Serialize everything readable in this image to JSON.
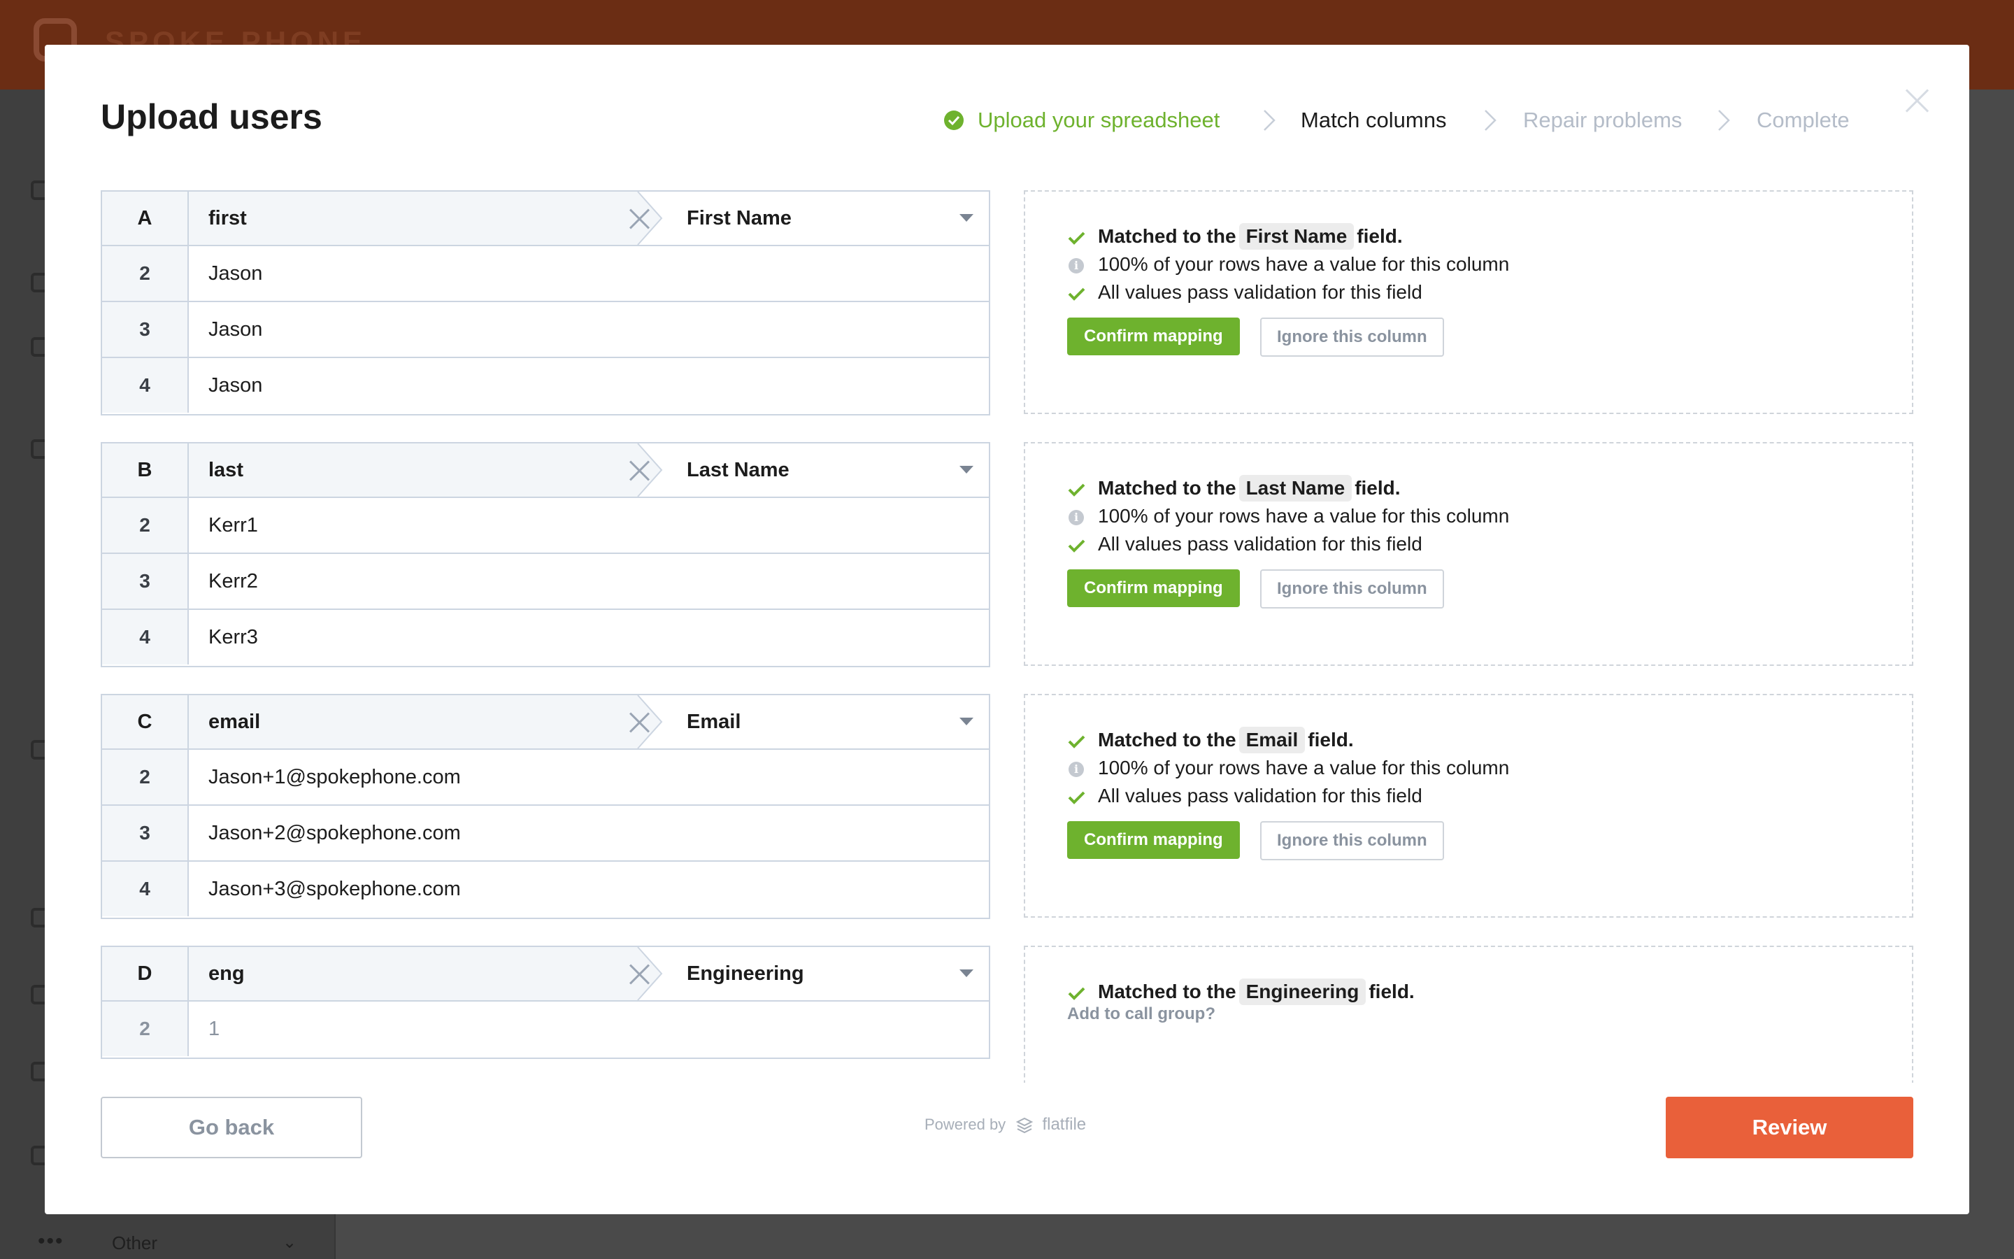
{
  "background_app": {
    "brand": "SPOKE PHONE",
    "sidebar_other_label": "Other",
    "colors": {
      "topbar": "#6b2d14"
    }
  },
  "modal": {
    "title": "Upload users",
    "close_icon": "close-icon"
  },
  "stepper": {
    "steps": [
      {
        "label": "Upload your spreadsheet",
        "state": "done"
      },
      {
        "label": "Match columns",
        "state": "current"
      },
      {
        "label": "Repair problems",
        "state": "todo"
      },
      {
        "label": "Complete",
        "state": "todo"
      }
    ]
  },
  "columns": [
    {
      "letter": "A",
      "header": "first",
      "matched_field": "First Name",
      "rows": [
        {
          "num": "2",
          "value": "Jason"
        },
        {
          "num": "3",
          "value": "Jason"
        },
        {
          "num": "4",
          "value": "Jason"
        }
      ],
      "info": {
        "matched_prefix": "Matched to the",
        "matched_field": "First Name",
        "matched_suffix": "field.",
        "rows_stat": "100% of your rows have a value for this column",
        "validation": "All values pass validation for this field"
      },
      "confirm_label": "Confirm mapping",
      "ignore_label": "Ignore this column"
    },
    {
      "letter": "B",
      "header": "last",
      "matched_field": "Last Name",
      "rows": [
        {
          "num": "2",
          "value": "Kerr1"
        },
        {
          "num": "3",
          "value": "Kerr2"
        },
        {
          "num": "4",
          "value": "Kerr3"
        }
      ],
      "info": {
        "matched_prefix": "Matched to the",
        "matched_field": "Last Name",
        "matched_suffix": "field.",
        "rows_stat": "100% of your rows have a value for this column",
        "validation": "All values pass validation for this field"
      },
      "confirm_label": "Confirm mapping",
      "ignore_label": "Ignore this column"
    },
    {
      "letter": "C",
      "header": "email",
      "matched_field": "Email",
      "rows": [
        {
          "num": "2",
          "value": "Jason+1@spokephone.com"
        },
        {
          "num": "3",
          "value": "Jason+2@spokephone.com"
        },
        {
          "num": "4",
          "value": "Jason+3@spokephone.com"
        }
      ],
      "info": {
        "matched_prefix": "Matched to the",
        "matched_field": "Email",
        "matched_suffix": "field.",
        "rows_stat": "100% of your rows have a value for this column",
        "validation": "All values pass validation for this field"
      },
      "confirm_label": "Confirm mapping",
      "ignore_label": "Ignore this column"
    },
    {
      "letter": "D",
      "header": "eng",
      "matched_field": "Engineering",
      "rows": [
        {
          "num": "2",
          "value": "1"
        }
      ],
      "info": {
        "matched_prefix": "Matched to the",
        "matched_field": "Engineering",
        "matched_suffix": "field.",
        "sub_note": "Add to call group?"
      }
    }
  ],
  "footer": {
    "back_label": "Go back",
    "powered_by": "Powered by",
    "powered_brand": "flatfile",
    "review_label": "Review"
  },
  "colors": {
    "accent_green": "#6eb22e",
    "review_orange": "#e9603a",
    "muted": "#b4bcc8"
  }
}
